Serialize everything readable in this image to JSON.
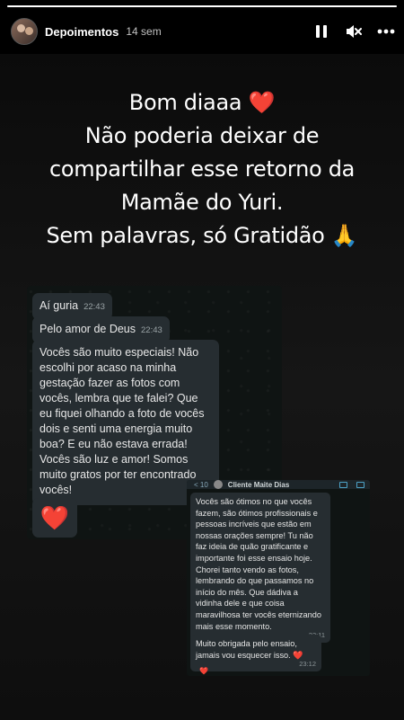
{
  "story": {
    "progress": 1.0,
    "username": "Depoimentos",
    "time_ago": "14 sem",
    "icons": {
      "pause": "pause-icon",
      "mute": "speaker-muted-icon",
      "more": "more-horizontal-icon"
    }
  },
  "caption": {
    "line1": "Bom diaaa",
    "line1_emoji": "❤️",
    "line2": "Não poderia deixar de",
    "line3": "compartilhar esse retorno da",
    "line4": "Mamãe do Yuri.",
    "line5": "Sem palavras, só Gratidão",
    "line5_emoji": "🙏"
  },
  "chat1": {
    "messages": [
      {
        "text": "Aí guria",
        "time": "22:43"
      },
      {
        "text": "Pelo amor de Deus",
        "time": "22:43"
      },
      {
        "text": "Vocês são muito especiais! Não escolhi por acaso na minha gestação fazer as fotos com vocês, lembra que te falei? Que eu fiquei olhando a foto de vocês dois e senti uma energia muito boa? E eu não estava errada! Vocês são luz e amor! Somos muito gratos por ter encontrado vocês!"
      },
      {
        "text": "❤️"
      }
    ]
  },
  "chat2": {
    "header": {
      "back": "< 10",
      "name": "Cliente Maite Dias"
    },
    "messages": [
      {
        "text": "Vocês são ótimos no que vocês fazem, são ótimos profissionais e pessoas incríveis que estão em nossas orações sempre! Tu não faz ideia de quão gratificante e importante foi esse ensaio hoje. Chorei tanto vendo as fotos, lembrando do que passamos no início do mês. Que dádiva a vidinha dele e que coisa maravilhosa ter vocês eternizando mais esse momento.",
        "time": "23:11"
      },
      {
        "text": "Muito obrigada pelo ensaio, jamais vou esquecer isso. ❤️",
        "time": "23:12"
      },
      {
        "text": "❤️"
      }
    ]
  },
  "colors": {
    "background": "#000000",
    "bubble": "#262d31",
    "heart": "#e5262b",
    "chat_bg": "#0f1413"
  }
}
